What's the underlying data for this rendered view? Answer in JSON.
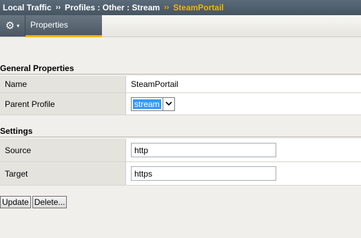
{
  "breadcrumb": {
    "items": [
      "Local Traffic",
      "Profiles : Other : Stream"
    ],
    "separator": "››",
    "current": "SteamPortail"
  },
  "toolbar": {
    "gear_icon": "gear-icon",
    "menu_caret": "▾"
  },
  "tabs": [
    {
      "label": "Properties",
      "active": true
    }
  ],
  "general": {
    "title": "General Properties",
    "name_label": "Name",
    "name_value": "SteamPortail",
    "parent_label": "Parent Profile",
    "parent_value": "stream"
  },
  "settings": {
    "title": "Settings",
    "source_label": "Source",
    "source_value": "http",
    "target_label": "Target",
    "target_value": "https"
  },
  "actions": {
    "update_label": "Update",
    "delete_label": "Delete..."
  },
  "colors": {
    "accent": "#f5b400",
    "header_bg": "#4e5d6a",
    "selection": "#3399ff"
  }
}
